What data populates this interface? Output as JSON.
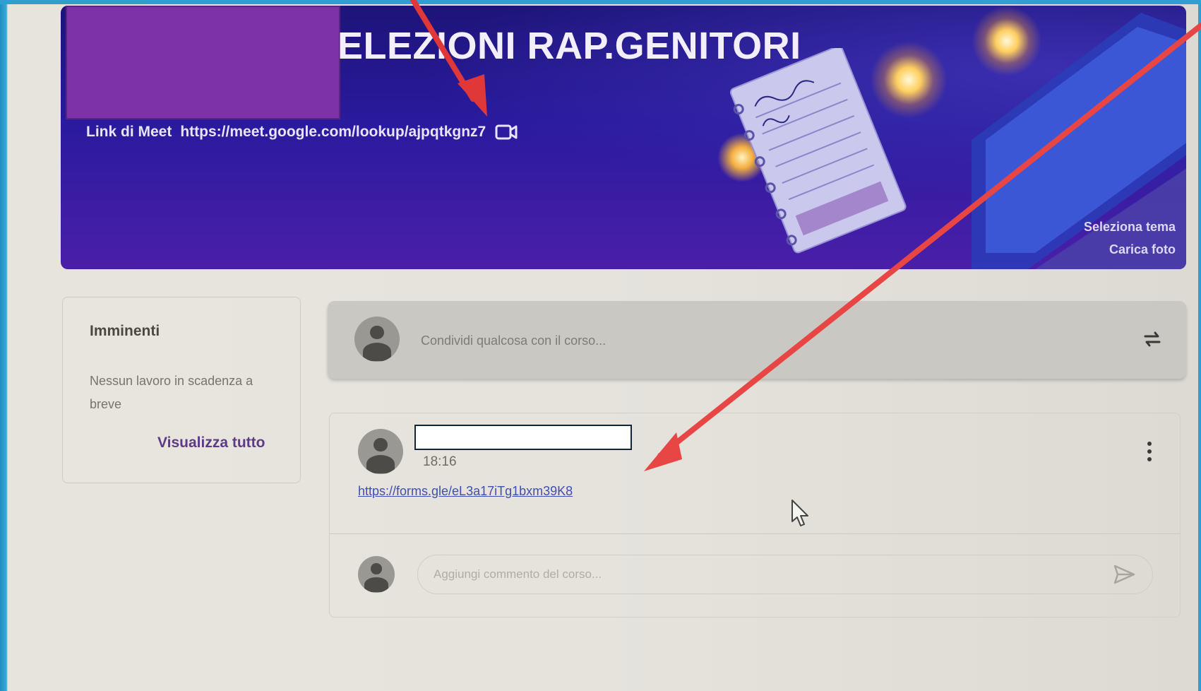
{
  "banner": {
    "title": "ELEZIONI RAP.GENITORI",
    "meet_label": "Link di Meet",
    "meet_url": "https://meet.google.com/lookup/ajpqtkgnz7",
    "select_theme": "Seleziona tema",
    "upload_photo": "Carica foto"
  },
  "upcoming": {
    "title": "Imminenti",
    "empty_text": "Nessun lavoro in scadenza a breve",
    "view_all": "Visualizza tutto"
  },
  "share": {
    "placeholder": "Condividi qualcosa con il corso..."
  },
  "post": {
    "time": "18:16",
    "link": "https://forms.gle/eL3a17iTg1bxm39K8",
    "comment_placeholder": "Aggiungi commento del corso..."
  },
  "colors": {
    "banner_dark": "#1d1478",
    "banner_light": "#4a1fa8",
    "link": "#3e4fb0",
    "annotation_arrow": "#e03838",
    "redaction_purple": "#7d32a8"
  },
  "icons": [
    "video-camera-icon",
    "repost-icon",
    "more-vert-icon",
    "send-icon",
    "avatar-icon",
    "mouse-cursor-icon"
  ]
}
